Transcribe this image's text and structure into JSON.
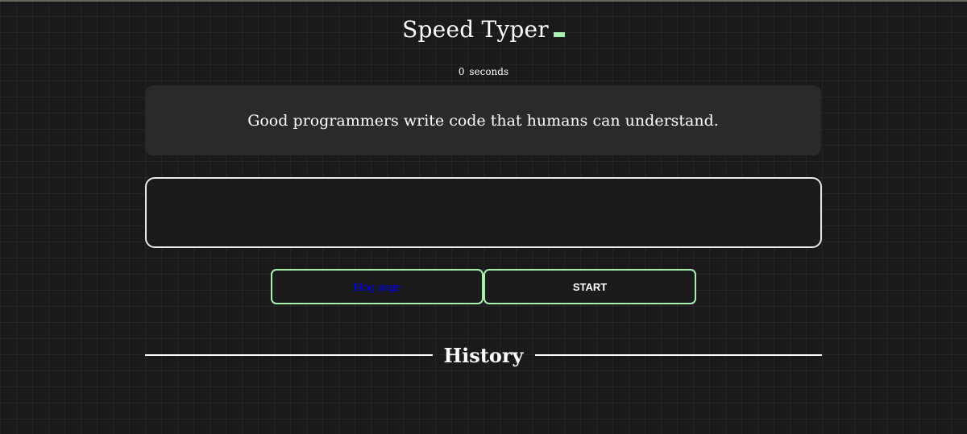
{
  "header": {
    "title": "Speed Typer"
  },
  "timer": {
    "value": "0",
    "unit": "seconds"
  },
  "quote": {
    "text": "Good programmers write code that humans can understand."
  },
  "input": {
    "value": "",
    "placeholder": ""
  },
  "buttons": {
    "blog_label": "Blog page",
    "start_label": "START"
  },
  "history": {
    "title": "History"
  },
  "colors": {
    "accent": "#a8f0b0",
    "background": "#1a1a1a",
    "panel": "#2a2a2a",
    "link": "#0000ee"
  }
}
